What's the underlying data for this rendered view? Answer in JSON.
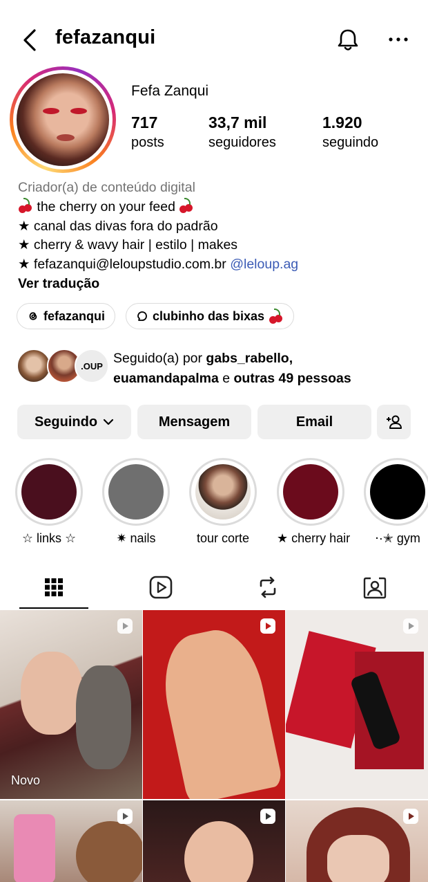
{
  "header": {
    "username": "fefazanqui"
  },
  "profile": {
    "full_name": "Fefa Zanqui",
    "stats": [
      {
        "value": "717",
        "label": "posts"
      },
      {
        "value": "33,7 mil",
        "label": "seguidores"
      },
      {
        "value": "1.920",
        "label": "seguindo"
      }
    ]
  },
  "bio": {
    "category": "Criador(a) de conteúdo digital",
    "line1": "the cherry on your feed",
    "line2": "★ canal das divas fora do padrão",
    "line3": "★ cherry & wavy hair | estilo | makes",
    "line4_text": "★ fefazanqui@leloupstudio.com.br",
    "line4_link": "@leloup.ag",
    "translate": "Ver tradução"
  },
  "chips": {
    "threads": "fefazanqui",
    "channel": "clubinho das bixas"
  },
  "followed_by": {
    "prefix": "Seguido(a) por",
    "user1": "gabs_rabello,",
    "user2": "euamandapalma",
    "conj": "e",
    "others": "outras 49 pessoas",
    "third_avatar_text": ".OUP"
  },
  "buttons": {
    "following": "Seguindo",
    "message": "Mensagem",
    "email": "Email"
  },
  "highlights": [
    {
      "label": "☆ links ☆",
      "color": "#4a0f1e"
    },
    {
      "label": "✷ nails",
      "color": "#6f6f6f"
    },
    {
      "label": "tour corte",
      "color": "#bfa18b"
    },
    {
      "label": "★ cherry hair",
      "color": "#6b0b1c"
    },
    {
      "label": "⋅·✭ gym",
      "color": "#000000"
    }
  ],
  "tabs": [
    "grid-tab",
    "reels-tab",
    "reposts-tab",
    "tagged-tab"
  ],
  "grid": {
    "new_label": "Novo"
  },
  "colors": {
    "button_bg": "#efefef",
    "link": "#3b5bb5",
    "muted": "#737373"
  }
}
